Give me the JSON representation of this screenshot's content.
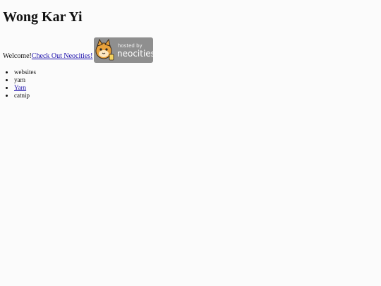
{
  "page": {
    "title": "Wong Kar Yi",
    "welcome_text": "Welcome! ",
    "neocities_link": "Check Out Neocities!",
    "badge": {
      "line1": "hosted by",
      "line2": "neocities",
      "bg_color": "#8f8f8f"
    },
    "list_items": [
      {
        "label": "websites",
        "is_link": false
      },
      {
        "label": "yarn",
        "is_link": false
      },
      {
        "label": "Yarn",
        "is_link": true
      },
      {
        "label": "catnip",
        "is_link": false
      }
    ]
  }
}
